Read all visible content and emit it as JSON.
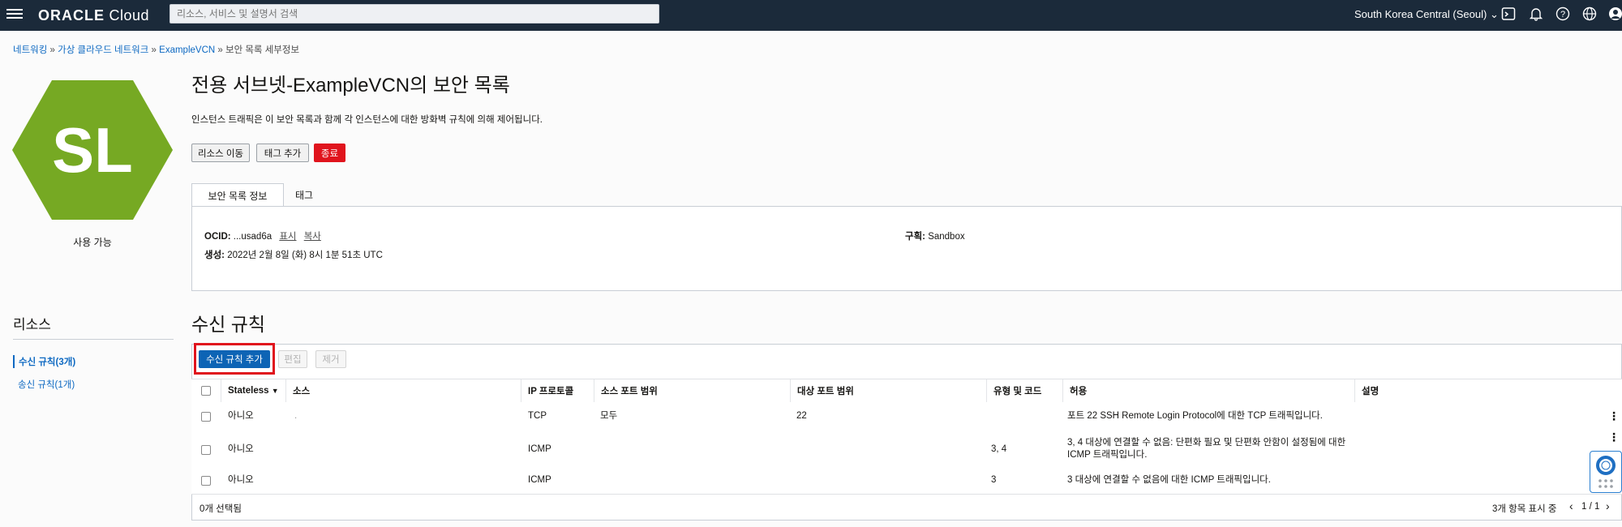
{
  "header": {
    "logo_brand": "ORACLE",
    "logo_product": "Cloud",
    "search_placeholder": "리소스, 서비스 및 설명서 검색",
    "region": "South Korea Central (Seoul)",
    "icons": [
      "cloud-shell-icon",
      "bell-icon",
      "help-icon",
      "globe-icon",
      "user-icon"
    ]
  },
  "breadcrumb": {
    "items": [
      "네트워킹",
      "가상 클라우드 네트워크",
      "ExampleVCN"
    ],
    "current": "보안 목록 세부정보",
    "separator": "»"
  },
  "resource_icon": {
    "initials": "SL",
    "status": "사용 가능",
    "color": "#76a923"
  },
  "page": {
    "title": "전용 서브넷-ExampleVCN의 보안 목록",
    "description": "인스턴스 트래픽은 이 보안 목록과 함께 각 인스턴스에 대한 방화벽 규칙에 의해 제어됩니다."
  },
  "actions": {
    "move": "리소스 이동",
    "add_tag": "태그 추가",
    "terminate": "종료"
  },
  "tabs": [
    "보안 목록 정보",
    "태그"
  ],
  "info": {
    "ocid_label": "OCID:",
    "ocid_value": "...usad6a",
    "show_link": "표시",
    "copy_link": "복사",
    "created_label": "생성:",
    "created_value": "2022년 2월 8일 (화) 8시 1분 51초 UTC",
    "compartment_label": "구획:",
    "compartment_value": "Sandbox"
  },
  "sidebar": {
    "title": "리소스",
    "items": [
      "수신 규칙(3개)",
      "송신 규칙(1개)"
    ]
  },
  "rules": {
    "title": "수신 규칙",
    "add_button": "수신 규칙 추가",
    "edit_button": "편집",
    "remove_button": "제거",
    "columns": [
      "Stateless",
      "소스",
      "IP 프로토콜",
      "소스 포트 범위",
      "대상 포트 범위",
      "유형 및 코드",
      "허용",
      "설명"
    ],
    "rows": [
      {
        "stateless": "아니오",
        "source": ".",
        "protocol": "TCP",
        "src_port": "모두",
        "dst_port": "22",
        "type_code": "",
        "allows": "포트 22 SSH Remote Login Protocol에 대한 TCP 트래픽입니다.",
        "desc": ""
      },
      {
        "stateless": "아니오",
        "source": "",
        "protocol": "ICMP",
        "src_port": "",
        "dst_port": "",
        "type_code": "3, 4",
        "allows": "3, 4 대상에 연결할 수 없음: 단편화 필요 및 단편화 안함이 설정됨에 대한 ICMP 트래픽입니다.",
        "desc": ""
      },
      {
        "stateless": "아니오",
        "source": "",
        "protocol": "ICMP",
        "src_port": "",
        "dst_port": "",
        "type_code": "3",
        "allows": "3 대상에 연결할 수 없음에 대한 ICMP 트래픽입니다.",
        "desc": ""
      }
    ],
    "selected_text": "0개 선택됨",
    "showing_text": "3개 항목 표시 중",
    "page_text": "1 / 1"
  }
}
